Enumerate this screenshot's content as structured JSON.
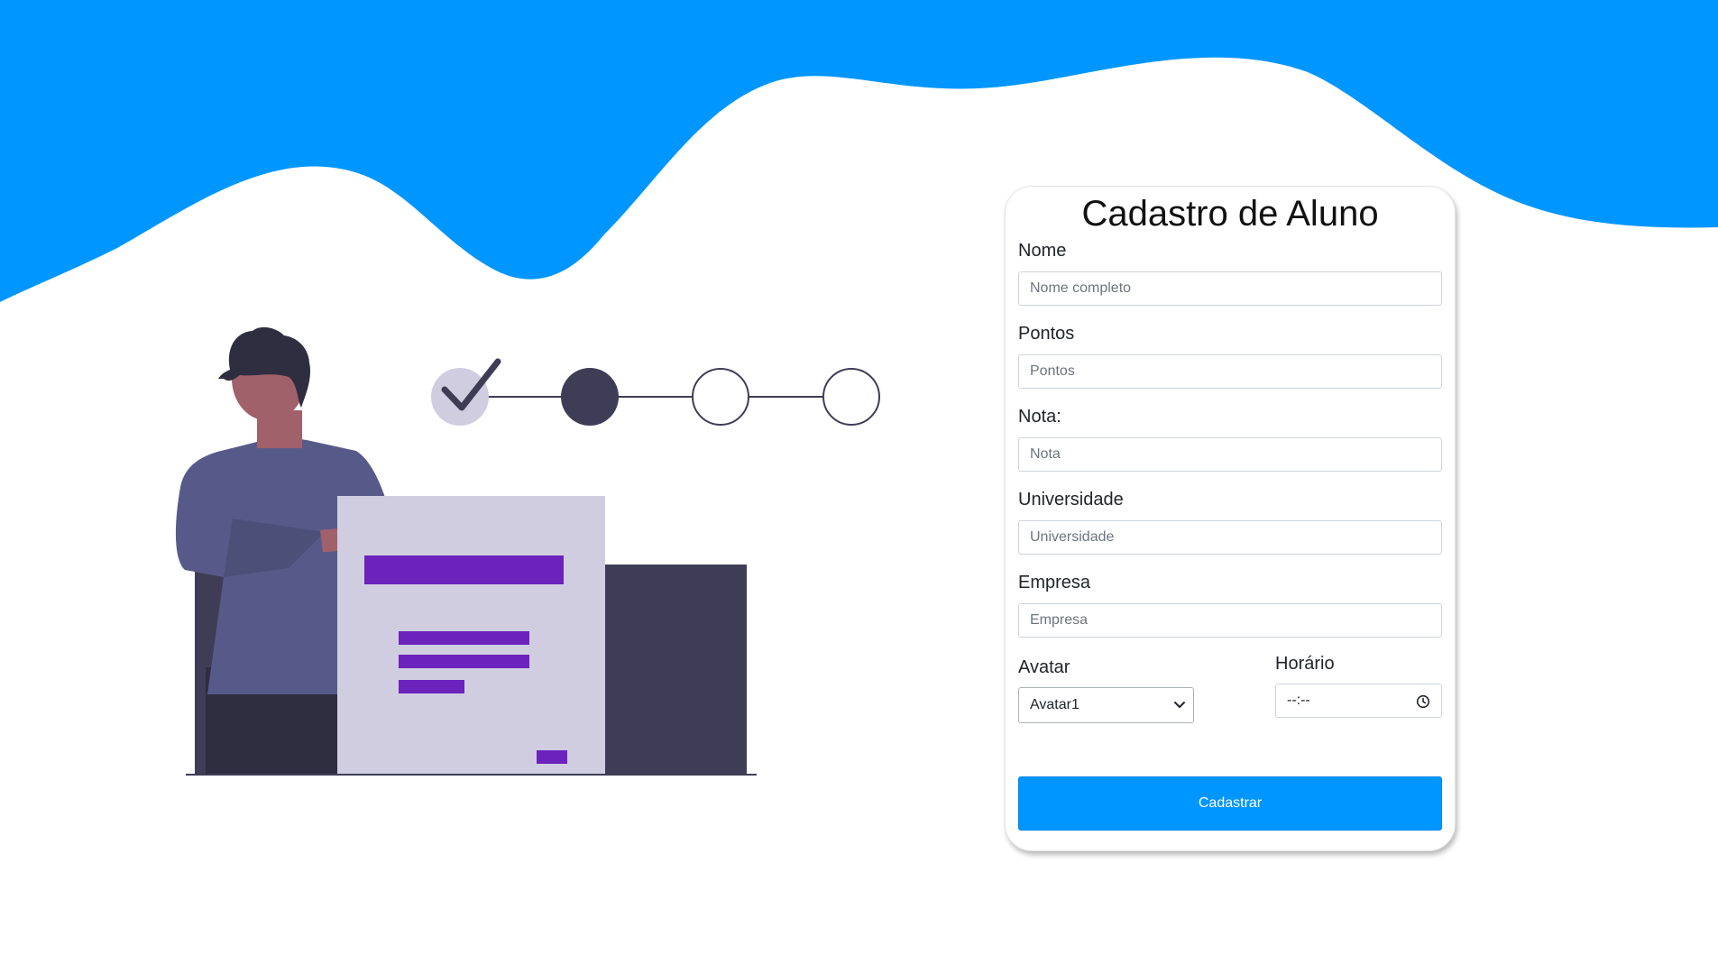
{
  "colors": {
    "wave": "#0096ff",
    "button": "#0096ff",
    "illustration_dark": "#3f3d56",
    "illustration_purple": "#6c22bd",
    "illustration_light": "#d0cde1",
    "shirt": "#575a89",
    "skin": "#a0616a",
    "hair": "#2f2e41"
  },
  "form": {
    "title": "Cadastro de Aluno",
    "fields": [
      {
        "label": "Nome",
        "placeholder": "Nome completo"
      },
      {
        "label": "Pontos",
        "placeholder": "Pontos"
      },
      {
        "label": "Nota:",
        "placeholder": "Nota"
      },
      {
        "label": "Universidade",
        "placeholder": "Universidade"
      },
      {
        "label": "Empresa",
        "placeholder": "Empresa"
      }
    ],
    "avatar": {
      "label": "Avatar",
      "selected": "Avatar1",
      "icon": "chevron-down-icon"
    },
    "horario": {
      "label": "Horário",
      "value": "--:--",
      "icon": "clock-icon"
    },
    "submit_label": "Cadastrar"
  },
  "illustration": {
    "steps": [
      "completed",
      "current",
      "pending",
      "pending"
    ]
  }
}
